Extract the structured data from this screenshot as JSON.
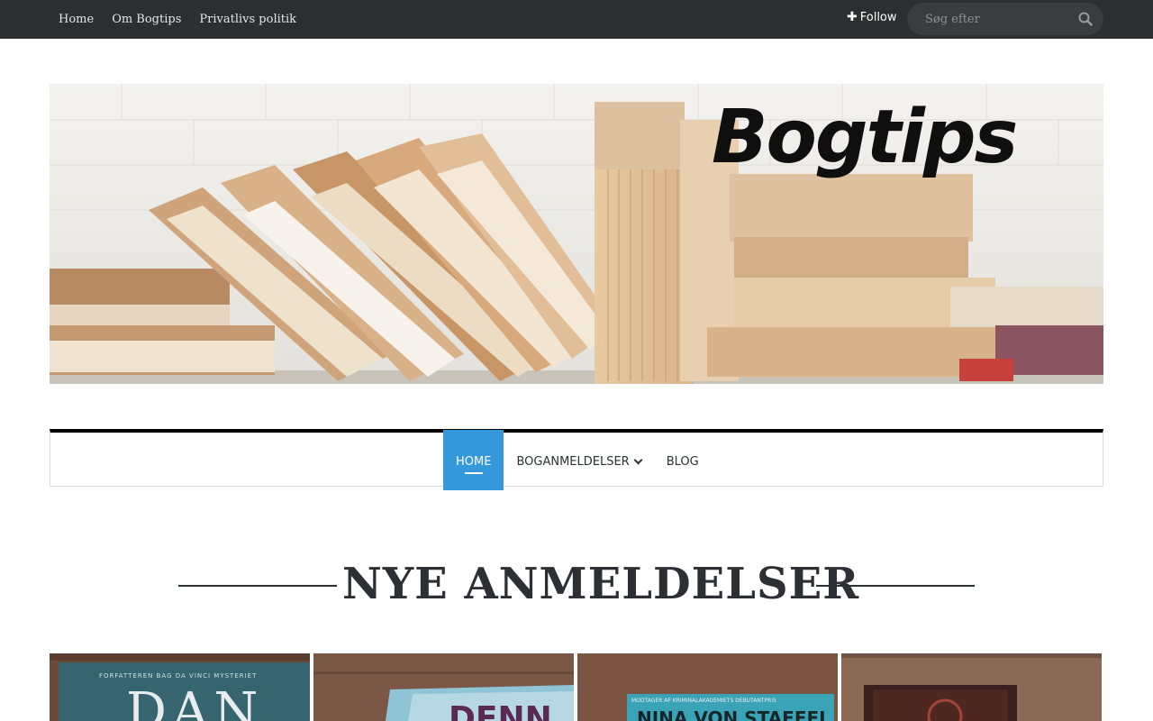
{
  "top_nav": {
    "links": [
      "Home",
      "Om Bogtips",
      "Privatlivs politik"
    ],
    "follow_label": "Follow",
    "search_placeholder": "Søg efter"
  },
  "header": {
    "logo_text": "Bogtips"
  },
  "main_nav": {
    "items": [
      {
        "label": "HOME",
        "active": true
      },
      {
        "label": "BOGANMELDELSER",
        "has_dropdown": true
      },
      {
        "label": "BLOG"
      }
    ]
  },
  "section": {
    "title": "NYE ANMELDELSER"
  },
  "reviews": [
    {
      "cover_top": "FORFATTEREN BAG DA VINCI MYSTERIET",
      "cover_main": "DAN"
    },
    {
      "cover_top": "",
      "cover_main": "DENN"
    },
    {
      "cover_top": "MODTAGER AF KRIMINALAKADEMIETS DEBUTANTPRIS",
      "cover_main": "NINA VON STAFFEL"
    },
    {
      "cover_top": "",
      "cover_main": ""
    }
  ],
  "colors": {
    "topbar": "#2c2e32",
    "accent": "#3498db",
    "text": "#2c2f34"
  }
}
